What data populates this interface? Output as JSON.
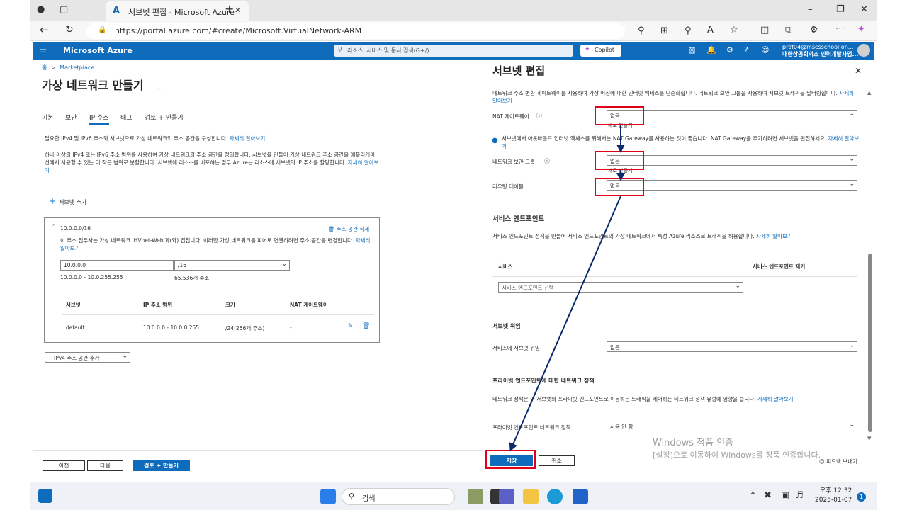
{
  "browser": {
    "tab_title": "서브넷 편집 - Microsoft Azure",
    "url": "https://portal.azure.com/#create/Microsoft.VirtualNetwork-ARM"
  },
  "azure_header": {
    "brand": "Microsoft Azure",
    "search_placeholder": "리소스, 서비스 및 문서 검색(G+/)",
    "copilot": "Copilot",
    "account_email": "prof04@mscsschool.on...",
    "account_org": "대한상공회의소 인력개발사업..."
  },
  "left": {
    "breadcrumb_home": "홈",
    "breadcrumb_sep": ">",
    "breadcrumb_marketplace": "Marketplace",
    "title": "가상 네트워크 만들기",
    "title_more": "...",
    "tabs": [
      "기본",
      "보안",
      "IP 주소",
      "태그",
      "검토 + 만들기"
    ],
    "desc1": "필요한 IPv4 및 IPv6 주소와 서브넷으로 가상 네트워크의 주소 공간을 구성합니다.",
    "desc1_link": "자세히 알아보기",
    "desc2": "하나 이상의 IPv4 또는 IPv6 주소 범위를 사용하여 가상 네트워크의 주소 공간을 정의합니다. 서브넷을 만들어 가상 네트워크 주소 공간을 애플리케이션에서 사용할 수 있는 더 작은 범위로 분할합니다. 서브넷에 리소스를 배포하는 경우 Azure는 리소스에 서브넷의 IP 주소를 할당합니다.",
    "desc2_link": "자세히 알아보기",
    "add_subnet": "서브넷 추가",
    "space": {
      "header": "10.0.0.0/16",
      "delete": "주소 공간 삭제",
      "warning": "이 주소 접두사는 가상 네트워크 'HVnet-Web'과(와) 겹칩니다. 이러한 가상 네트워크를 피어로 연결하려면 주소 공간을 변경합니다.",
      "warning_link": "자세히 알아보기",
      "address": "10.0.0.0",
      "prefix": "/16",
      "range": "10.0.0.0 - 10.0.255.255",
      "count": "65,536개 주소",
      "columns": [
        "서브넷",
        "IP 주소 범위",
        "크기",
        "NAT 게이트웨이"
      ],
      "row": {
        "name": "default",
        "range": "10.0.0.0 - 10.0.0.255",
        "size": "/24(256개 주소)",
        "nat": "-"
      }
    },
    "add_space": "IPv4 주소 공간 추가",
    "buttons": {
      "prev": "이전",
      "next": "다음",
      "review": "검토 + 만들기"
    }
  },
  "panel": {
    "title": "서브넷 편집",
    "intro": "네트워크 주소 변환 게이트웨이를 사용하여 가상 머신에 대한 인터넷 액세스를 단순화합니다. 네트워크 보안 그룹을 사용하여 서브넷 트래픽을 필터링합니다.",
    "intro_link": "자세히 알아보기",
    "nat_label": "NAT 게이트웨이",
    "nat_value": "없음",
    "nat_create": "새로 만들기",
    "info": "서브넷에서 아웃바운드 인터넷 액세스를 위해서는 NAT Gateway를 사용하는 것이 좋습니다. NAT Gateway를 추가하려면 서브넷을 편집하세요.",
    "info_link": "자세히 알아보기",
    "nsg_label": "네트워크 보안 그룹",
    "nsg_value": "없음",
    "nsg_create": "새로 만들기",
    "route_label": "라우팅 테이블",
    "route_value": "없음",
    "endpoint_head": "서비스 엔드포인트",
    "endpoint_desc": "서비스 엔드포인트 정책을 만들어 서비스 엔드포인트의 가상 네트워크에서 특정 Azure 리소스로 트래픽을 허용합니다.",
    "endpoint_link": "자세히 알아보기",
    "col_service": "서비스",
    "col_remove": "서비스 엔드포인트 제거",
    "service_select": "서비스 엔드포인트 선택",
    "delegation_head": "서브넷 위임",
    "delegation_label": "서비스에 서브넷 위임",
    "delegation_value": "없음",
    "private_head": "프라이빗 엔드포인트에 대한 네트워크 정책",
    "private_desc": "네트워크 정책은 이 서브넷의 프라이빗 엔드포인트로 이동하는 트래픽을 제어하는 네트워크 정책 유형에 영향을 줍니다.",
    "private_link": "자세히 알아보기",
    "private_label": "프라이빗 엔드포인트 네트워크 정책",
    "private_value": "사용 안 함",
    "save": "저장",
    "cancel": "취소",
    "feedback": "피드백 보내기"
  },
  "watermark": {
    "line1": "Windows 정품 인증",
    "line2": "[설정]으로 이동하여 Windows를 정품 인증합니다."
  },
  "taskbar": {
    "search": "검색",
    "time": "오후 12:32",
    "date": "2025-01-07",
    "badge": "1"
  },
  "colors": {
    "azure_blue": "#0f6cbd",
    "highlight_red": "#e0001b",
    "arrow_navy": "#0b2a6b"
  }
}
